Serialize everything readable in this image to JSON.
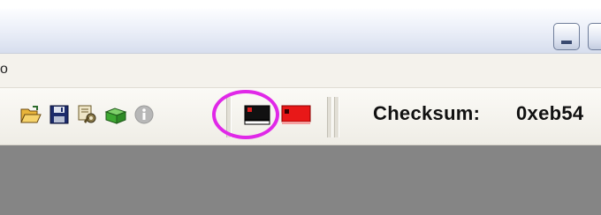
{
  "window": {
    "minimize_icon": "minimize-icon",
    "close_icon": "close-icon"
  },
  "menubar": {
    "partial_item": "o"
  },
  "toolbar": {
    "icons": [
      "open-folder-icon",
      "save-icon",
      "settings-icon",
      "package-icon",
      "info-icon",
      "black-board-icon",
      "red-board-icon"
    ],
    "checksum_label": "Checksum:",
    "checksum_value": "0xeb54"
  },
  "annotation": {
    "color": "#e028e8"
  },
  "colors": {
    "workspace": "#858585",
    "toolbar_bg": "#efede6"
  }
}
